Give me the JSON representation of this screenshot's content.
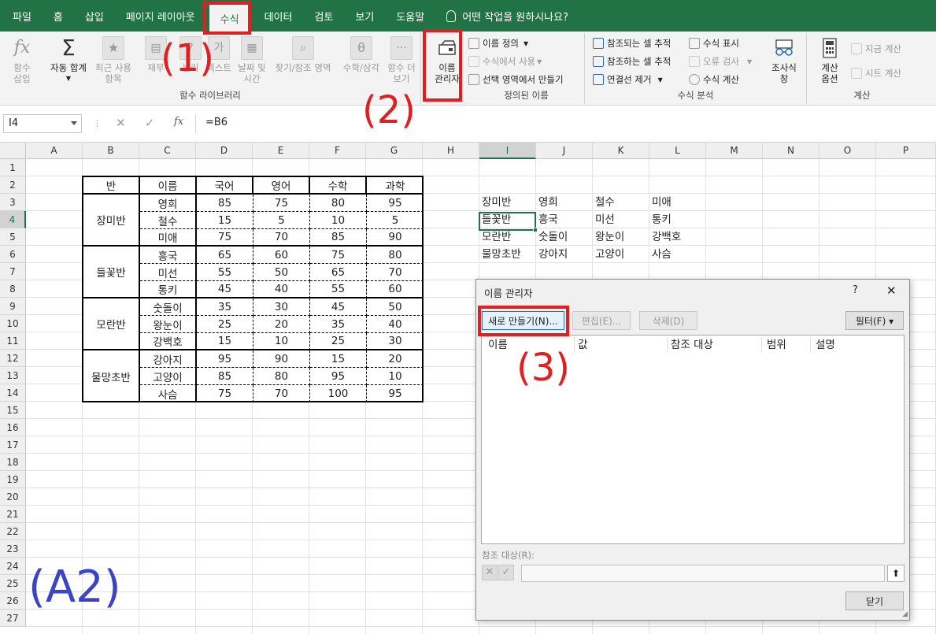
{
  "menu": {
    "tabs": [
      "파일",
      "홈",
      "삽입",
      "페이지 레이아웃",
      "수식",
      "데이터",
      "검토",
      "보기",
      "도움말"
    ],
    "active_tab": "수식",
    "tell_me": "어떤 작업을 원하시나요?"
  },
  "ribbon": {
    "function_library": {
      "group_label": "함수 라이브러리",
      "insert_function": "함수\n삽입",
      "autosum": "자동 합계",
      "recent": "최근 사용\n항목",
      "financial": "재무",
      "logical": "논리",
      "text": "텍스트",
      "datetime": "날짜 및\n시간",
      "lookup": "찾기/참조 영역",
      "math": "수학/삼각",
      "more": "함수 더\n보기"
    },
    "defined_names": {
      "group_label": "정의된 이름",
      "name_manager": "이름\n관리자",
      "define_name": "이름 정의",
      "use_in_formula": "수식에서 사용",
      "create_from_selection": "선택 영역에서 만들기"
    },
    "formula_auditing": {
      "group_label": "수식 분석",
      "trace_precedents": "참조되는 셀 추적",
      "trace_dependents": "참조하는 셀 추적",
      "remove_arrows": "연결선 제거",
      "show_formulas": "수식 표시",
      "error_checking": "오류 검사",
      "evaluate_formula": "수식 계산",
      "watch_window": "조사식\n창"
    },
    "calculation": {
      "group_label": "계산",
      "calc_options": "계산\n옵션",
      "calc_now": "지금 계산",
      "calc_sheet": "시트 계산"
    }
  },
  "formula_bar": {
    "name_box": "I4",
    "formula": "=B6",
    "cancel_glyph": "✕",
    "enter_glyph": "✓",
    "fx_glyph": "fx"
  },
  "grid": {
    "columns": [
      "A",
      "B",
      "C",
      "D",
      "E",
      "F",
      "G",
      "H",
      "I",
      "J",
      "K",
      "L",
      "M",
      "N",
      "O",
      "P"
    ],
    "rows": [
      "1",
      "2",
      "3",
      "4",
      "5",
      "6",
      "7",
      "8",
      "9",
      "10",
      "11",
      "12",
      "13",
      "14",
      "15",
      "16",
      "17",
      "18",
      "19",
      "20",
      "21",
      "22",
      "23",
      "24",
      "25",
      "26",
      "27"
    ],
    "selected_column": "I",
    "selected_row": "4"
  },
  "score_table": {
    "headers": [
      "반",
      "이름",
      "국어",
      "영어",
      "수학",
      "과학"
    ],
    "groups": [
      {
        "class": "장미반",
        "rows": [
          [
            "영희",
            "85",
            "75",
            "80",
            "95"
          ],
          [
            "철수",
            "15",
            "5",
            "10",
            "5"
          ],
          [
            "미애",
            "75",
            "70",
            "85",
            "90"
          ]
        ]
      },
      {
        "class": "들꽃반",
        "rows": [
          [
            "흥국",
            "65",
            "60",
            "75",
            "80"
          ],
          [
            "미선",
            "55",
            "50",
            "65",
            "70"
          ],
          [
            "통키",
            "45",
            "40",
            "55",
            "60"
          ]
        ]
      },
      {
        "class": "모란반",
        "rows": [
          [
            "숫돌이",
            "35",
            "30",
            "45",
            "50"
          ],
          [
            "왕눈이",
            "25",
            "20",
            "35",
            "40"
          ],
          [
            "강백호",
            "15",
            "10",
            "25",
            "30"
          ]
        ]
      },
      {
        "class": "물망초반",
        "rows": [
          [
            "강아지",
            "95",
            "90",
            "15",
            "20"
          ],
          [
            "고양이",
            "85",
            "80",
            "95",
            "10"
          ],
          [
            "사슴",
            "75",
            "70",
            "100",
            "95"
          ]
        ]
      }
    ]
  },
  "side_table": [
    [
      "장미반",
      "영희",
      "철수",
      "미애"
    ],
    [
      "들꽃반",
      "흥국",
      "미선",
      "통키"
    ],
    [
      "모란반",
      "숫돌이",
      "왕눈이",
      "강백호"
    ],
    [
      "물망초반",
      "강아지",
      "고양이",
      "사슴"
    ]
  ],
  "dialog": {
    "title": "이름 관리자",
    "help": "?",
    "close_x": "✕",
    "new_button": "새로 만들기(N)...",
    "edit_button": "편집(E)...",
    "delete_button": "삭제(D)",
    "filter_button": "필터(F) ▾",
    "list_headers": [
      "이름",
      "값",
      "참조 대상",
      "범위",
      "설명"
    ],
    "refers_to_label": "참조 대상(R):",
    "close_button": "닫기"
  },
  "annotations": {
    "step1": "(1)",
    "step2": "(2)",
    "step3": "(3)",
    "label": "(A2)"
  },
  "colors": {
    "excel_green": "#217346",
    "annotation_red": "#e02020",
    "annotation_blue": "#3b43c6"
  }
}
